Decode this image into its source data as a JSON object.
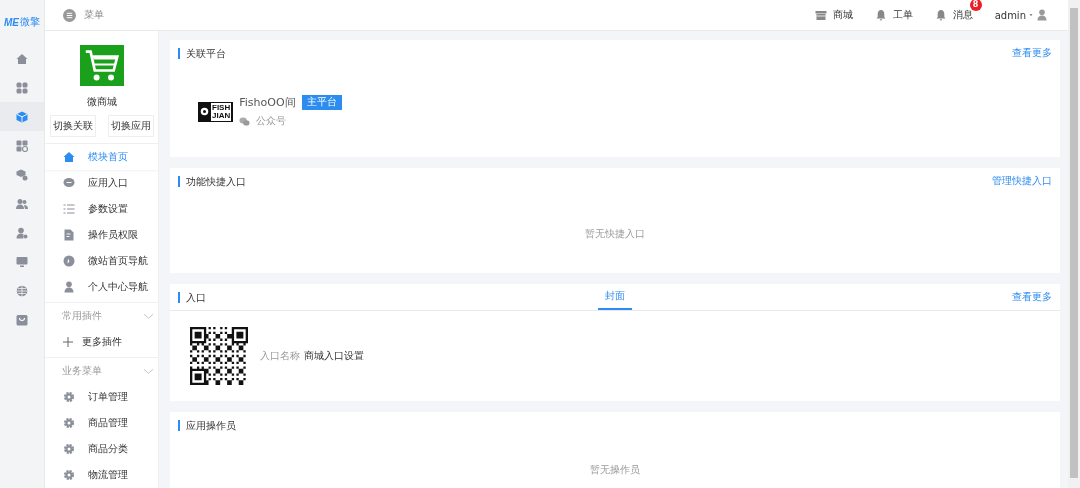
{
  "brand": {
    "mark": "ME",
    "name": "微擎"
  },
  "rail": [
    {
      "selected": false
    },
    {
      "selected": false
    },
    {
      "selected": true
    },
    {
      "selected": false
    },
    {
      "selected": false
    },
    {
      "selected": false
    },
    {
      "selected": false
    },
    {
      "selected": false
    },
    {
      "selected": false
    },
    {
      "selected": false
    }
  ],
  "topbar": {
    "menu_label": "菜单",
    "links": [
      {
        "label": "商城"
      },
      {
        "label": "工单"
      },
      {
        "label": "消息",
        "badge": "8"
      }
    ],
    "user": "admin"
  },
  "module": {
    "name": "微商城",
    "buttons": [
      "切换关联",
      "切换应用"
    ],
    "items": [
      {
        "label": "模块首页",
        "selected": true
      },
      {
        "label": "应用入口",
        "selected": false
      },
      {
        "label": "参数设置",
        "selected": false
      },
      {
        "label": "操作员权限",
        "selected": false
      },
      {
        "label": "微站首页导航",
        "selected": false
      },
      {
        "label": "个人中心导航",
        "selected": false
      }
    ],
    "sections": [
      {
        "title": "常用插件",
        "items": [
          {
            "label": "更多插件"
          }
        ]
      },
      {
        "title": "业务菜单",
        "items": [
          {
            "label": "订单管理"
          },
          {
            "label": "商品管理"
          },
          {
            "label": "商品分类"
          },
          {
            "label": "物流管理"
          }
        ]
      }
    ]
  },
  "cards": [
    {
      "kind": "platform",
      "title": "关联平台",
      "action": "查看更多",
      "platform": {
        "logo_lines": [
          "FISH",
          "JIAN"
        ],
        "name": "FishoOO间",
        "tag": "主平台",
        "type": "公众号"
      }
    },
    {
      "kind": "empty",
      "title": "功能快捷入口",
      "action": "管理快捷入口",
      "empty": "暂无快捷入口"
    },
    {
      "kind": "entry",
      "title": "入口",
      "tabs": [
        {
          "label": "封面",
          "selected": true
        }
      ],
      "action": "查看更多",
      "field_label": "入口名称",
      "field_value": "商城入口设置"
    },
    {
      "kind": "empty",
      "title": "应用操作员",
      "empty": "暂无操作员"
    }
  ]
}
